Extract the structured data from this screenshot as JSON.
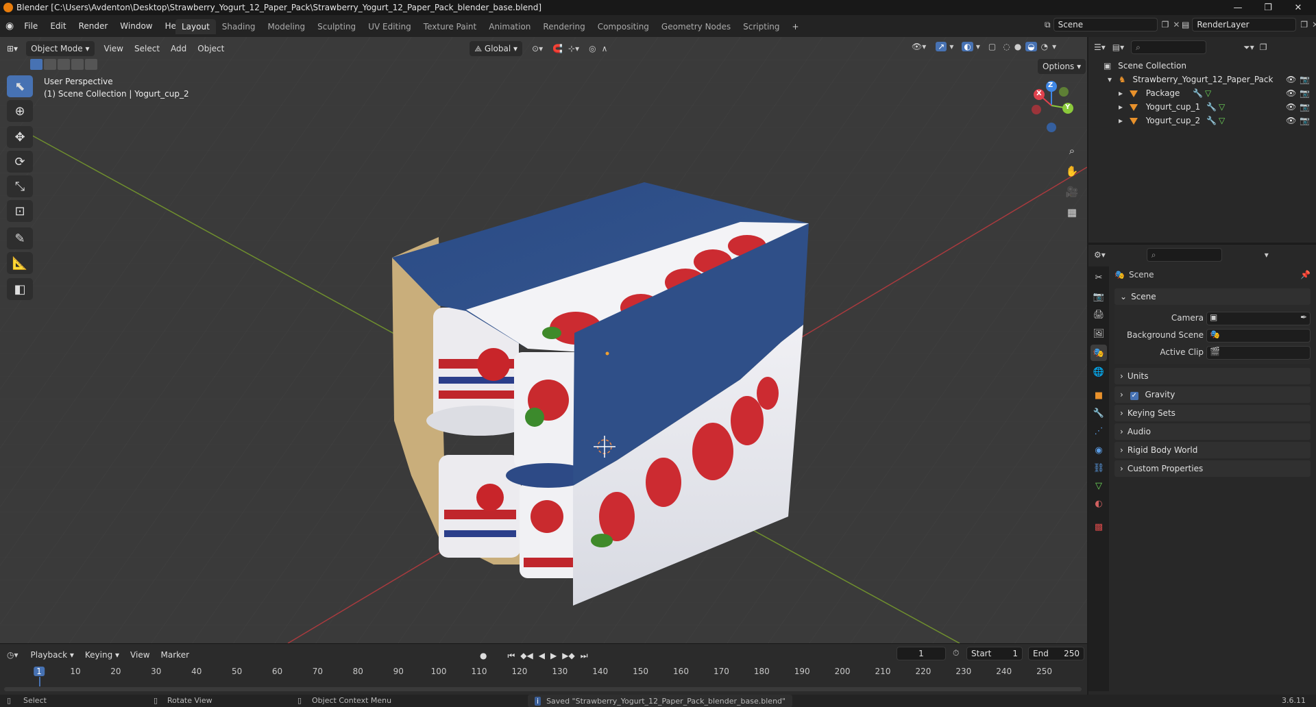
{
  "title_bar": {
    "title": "Blender [C:\\Users\\Avdenton\\Desktop\\Strawberry_Yogurt_12_Paper_Pack\\Strawberry_Yogurt_12_Paper_Pack_blender_base.blend]",
    "minimize": "—",
    "maximize": "❐",
    "close": "✕"
  },
  "menu": [
    "File",
    "Edit",
    "Render",
    "Window",
    "Help"
  ],
  "workspaces": [
    "Layout",
    "Shading",
    "Modeling",
    "Sculpting",
    "UV Editing",
    "Texture Paint",
    "Animation",
    "Rendering",
    "Compositing",
    "Geometry Nodes",
    "Scripting"
  ],
  "active_workspace": "Layout",
  "add_workspace": "+",
  "scene_field": "Scene",
  "render_layer_field": "RenderLayer",
  "viewport": {
    "mode": "Object Mode",
    "menus": [
      "View",
      "Select",
      "Add",
      "Object"
    ],
    "transform_orientation": "Global",
    "options_label": "Options",
    "overlay_line1": "User Perspective",
    "overlay_line2": "(1) Scene Collection | Yogurt_cup_2",
    "gizmo_axes": {
      "x": "X",
      "y": "Y",
      "z": "Z"
    },
    "tools": [
      "select-box",
      "cursor",
      "move",
      "rotate",
      "scale",
      "transform",
      "annotate",
      "measure",
      "add-cube"
    ]
  },
  "outliner": {
    "root": "Scene Collection",
    "collection": "Strawberry_Yogurt_12_Paper_Pack",
    "objects": [
      "Package",
      "Yogurt_cup_1",
      "Yogurt_cup_2"
    ]
  },
  "properties": {
    "header_title": "Scene",
    "section": "Scene",
    "fields": {
      "camera_label": "Camera",
      "background_scene_label": "Background Scene",
      "active_clip_label": "Active Clip"
    },
    "panels": [
      "Units",
      "Gravity",
      "Keying Sets",
      "Audio",
      "Rigid Body World",
      "Custom Properties"
    ],
    "gravity_checked": true
  },
  "timeline": {
    "menus": [
      "Playback",
      "Keying",
      "View",
      "Marker"
    ],
    "current_frame": "1",
    "start_label": "Start",
    "start_value": "1",
    "end_label": "End",
    "end_value": "250",
    "ticks": [
      "1",
      "10",
      "20",
      "30",
      "40",
      "50",
      "60",
      "70",
      "80",
      "90",
      "100",
      "110",
      "120",
      "130",
      "140",
      "150",
      "160",
      "170",
      "180",
      "190",
      "200",
      "210",
      "220",
      "230",
      "240",
      "250"
    ]
  },
  "status_bar": {
    "select": "Select",
    "rotate": "Rotate View",
    "context_menu": "Object Context Menu",
    "message": "Saved \"Strawberry_Yogurt_12_Paper_Pack_blender_base.blend\"",
    "version": "3.6.11"
  },
  "colors": {
    "accent": "#4772b3",
    "x_axis": "#e0424d",
    "y_axis": "#8bc93b",
    "z_axis": "#3f87e6",
    "package_blue": "#2e4f86"
  }
}
